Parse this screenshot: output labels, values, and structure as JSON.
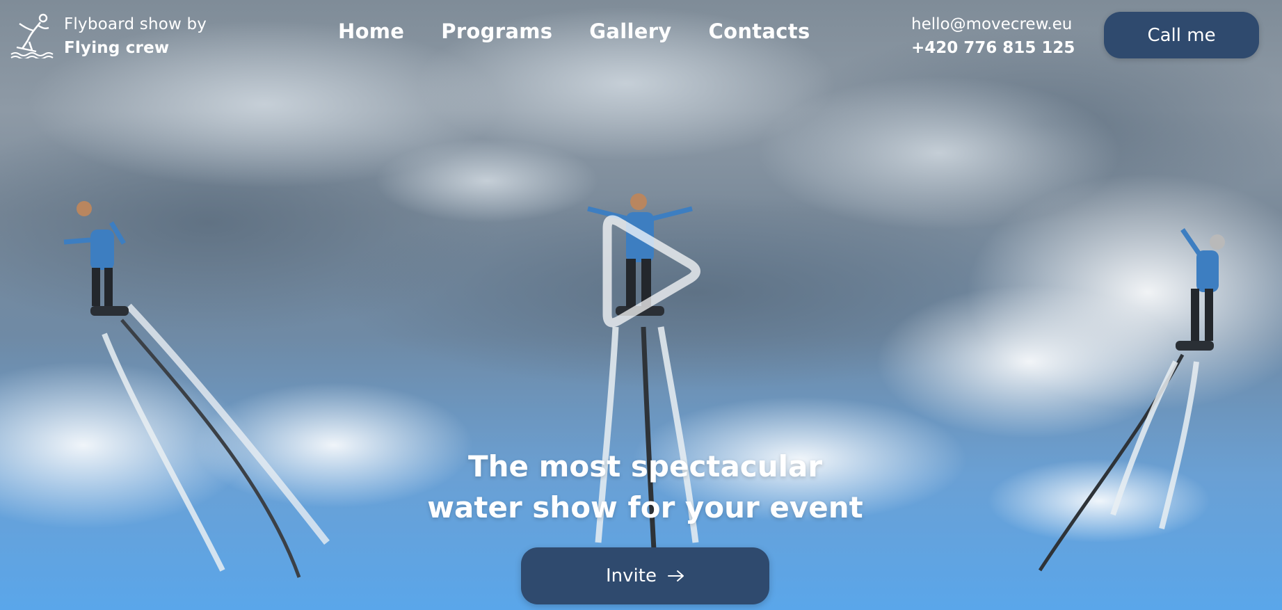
{
  "brand": {
    "line1": "Flyboard show by",
    "line2": "Flying crew",
    "logo_icon": "flyboard-rider-icon"
  },
  "nav": {
    "items": [
      {
        "label": "Home"
      },
      {
        "label": "Programs"
      },
      {
        "label": "Gallery"
      },
      {
        "label": "Contacts"
      }
    ]
  },
  "contact": {
    "email": "hello@movecrew.eu",
    "phone": "+420 776 815 125"
  },
  "call_button": {
    "label": "Call me"
  },
  "hero": {
    "play_icon": "play-icon",
    "headline_line1": "The most spectacular",
    "headline_line2": "water show for your event",
    "invite_label": "Invite",
    "invite_icon": "arrow-right-icon"
  },
  "colors": {
    "button_bg": "#2f4a6e",
    "text": "#ffffff",
    "sky_top": "#7f8c98",
    "sky_bottom": "#5aa6ea"
  }
}
